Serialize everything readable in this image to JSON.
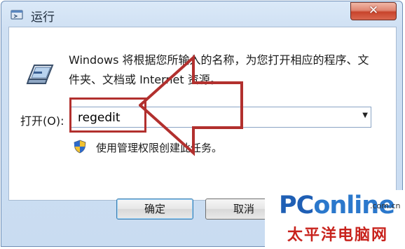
{
  "window": {
    "title": "运行",
    "close_symbol": "✕"
  },
  "dialog": {
    "description": "Windows 将根据您所输入的名称，为您打开相应的程序、文件夹、文档或 Internet 资源。",
    "open_label": "打开(O):",
    "open_value": "regedit",
    "admin_note": "使用管理权限创建此任务。"
  },
  "buttons": {
    "ok": "确定",
    "cancel": "取消"
  },
  "watermark": {
    "pc": "PC",
    "online": "online",
    "domain": ".com.cn",
    "site_cn": "太平洋电脑网"
  },
  "colors": {
    "annotation": "#b2302e",
    "brand_blue": "#1f5fb5",
    "brand_red": "#c8231d"
  },
  "icons": [
    "run-title-icon",
    "run-program-icon",
    "uac-shield-icon",
    "dropdown-arrow-icon",
    "close-icon",
    "annotation-arrow"
  ]
}
